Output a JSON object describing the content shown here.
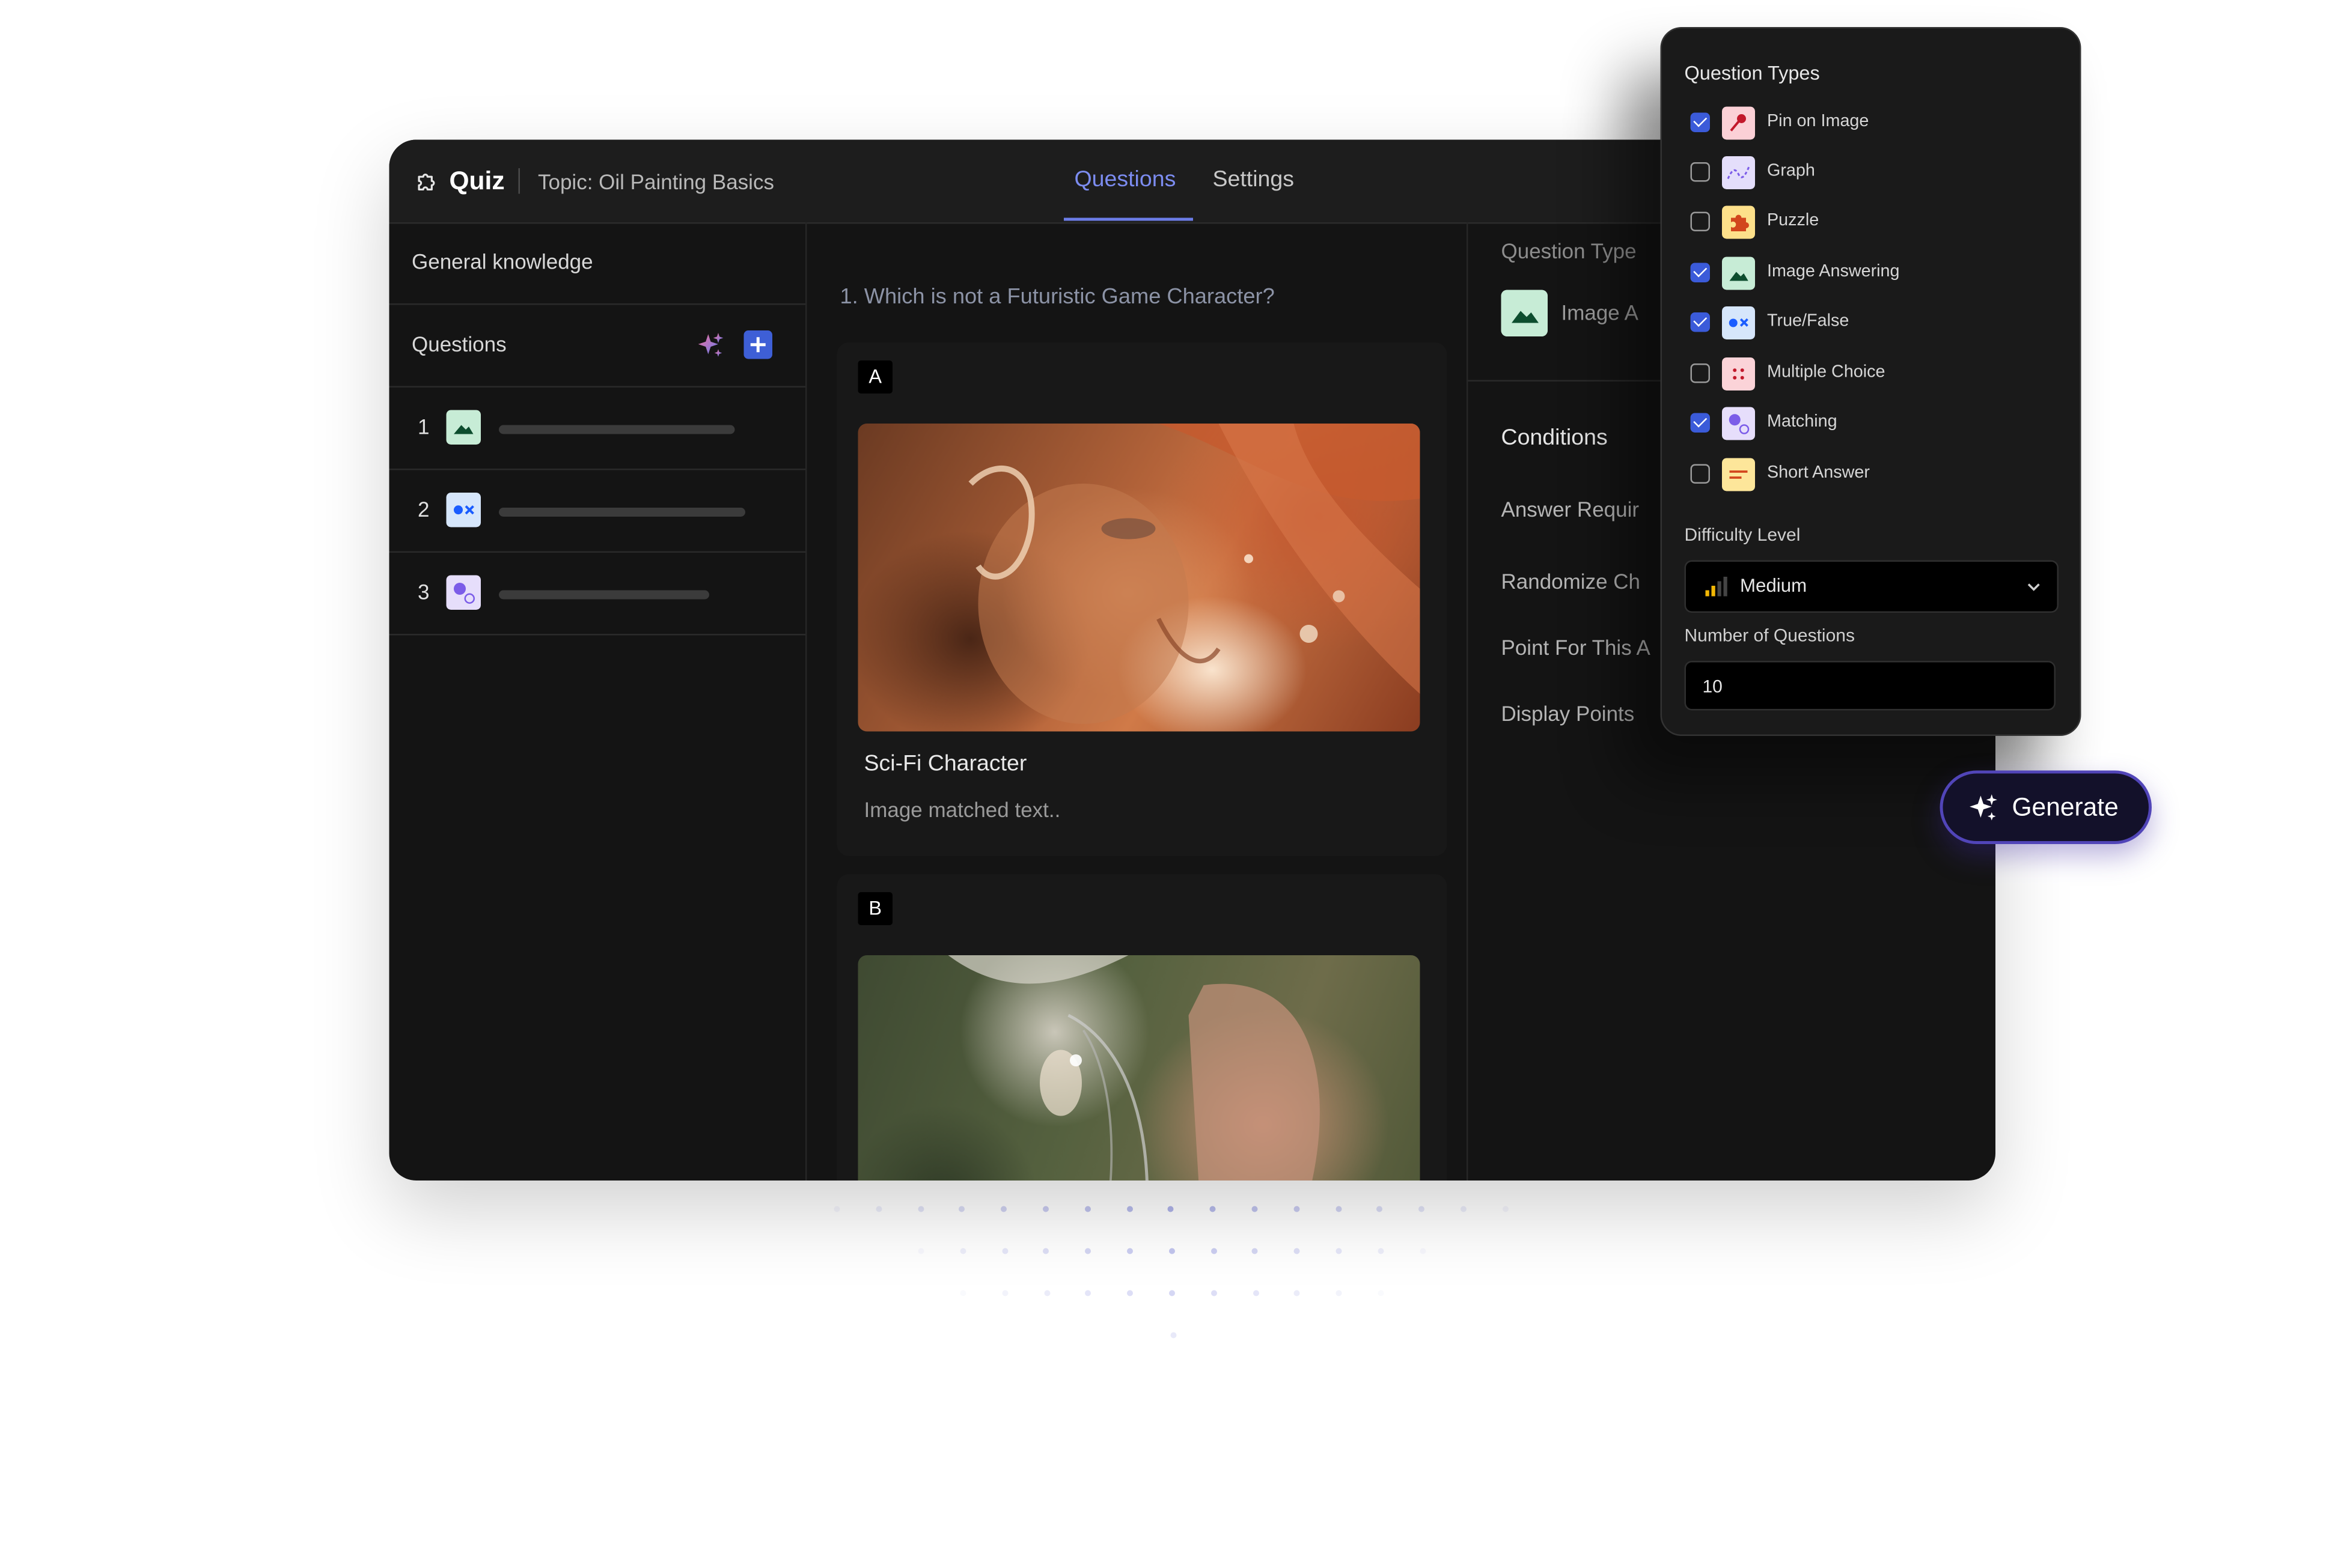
{
  "header": {
    "app_title": "Quiz",
    "topic": "Topic: Oil Painting Basics",
    "tabs": [
      {
        "label": "Questions",
        "active": true
      },
      {
        "label": "Settings",
        "active": false
      }
    ],
    "logo_icon": "puzzle-icon"
  },
  "sidebar": {
    "category": "General knowledge",
    "questions_label": "Questions",
    "questions": [
      {
        "number": "1",
        "icon": "image-answering-icon"
      },
      {
        "number": "2",
        "icon": "true-false-icon"
      },
      {
        "number": "3",
        "icon": "matching-icon"
      }
    ]
  },
  "main": {
    "question_title": "1. Which is not a Futuristic Game Character?",
    "options": [
      {
        "badge": "A",
        "caption_title": "Sci-Fi Character",
        "caption_sub": "Image matched text.."
      },
      {
        "badge": "B"
      }
    ]
  },
  "details": {
    "question_type_label": "Question Type",
    "question_type_value": "Image A",
    "conditions_title": "Conditions",
    "items": [
      "Answer Requir",
      "Randomize Ch",
      "Point For This A",
      "Display Points"
    ]
  },
  "question_types_panel": {
    "title": "Question Types",
    "options": [
      {
        "label": "Pin on Image",
        "checked": true,
        "icon": "pin-icon",
        "color": "#fbd0d6"
      },
      {
        "label": "Graph",
        "checked": false,
        "icon": "graph-icon",
        "color": "#e4defb"
      },
      {
        "label": "Puzzle",
        "checked": false,
        "icon": "puzzle-piece-icon",
        "color": "#fde08a"
      },
      {
        "label": "Image Answering",
        "checked": true,
        "icon": "image-icon",
        "color": "#c7ecd6"
      },
      {
        "label": "True/False",
        "checked": true,
        "icon": "true-false-icon",
        "color": "#d6e6fb"
      },
      {
        "label": "Multiple Choice",
        "checked": false,
        "icon": "dots-icon",
        "color": "#fbd3d8"
      },
      {
        "label": "Matching",
        "checked": true,
        "icon": "matching-icon",
        "color": "#e6defb"
      },
      {
        "label": "Short Answer",
        "checked": false,
        "icon": "short-answer-icon",
        "color": "#fde69a"
      }
    ],
    "difficulty_label": "Difficulty Level",
    "difficulty_value": "Medium",
    "count_label": "Number of Questions",
    "count_value": "10"
  },
  "generate_button": {
    "label": "Generate"
  },
  "colors": {
    "accent": "#6c7de8",
    "primary_blue": "#3b5bd9",
    "generate_border": "#5145b8"
  }
}
